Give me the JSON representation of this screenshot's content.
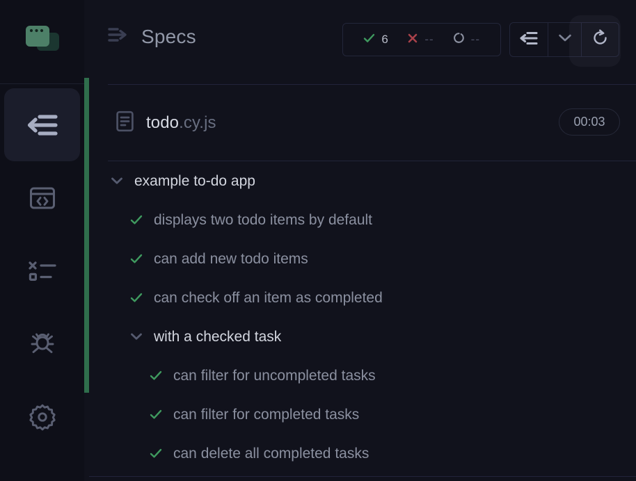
{
  "sidebar": {
    "logo": {
      "icon": "cypress-specs-logo-icon",
      "brand_color": "#4d8068",
      "shadow_color": "#1b3630"
    },
    "items": [
      {
        "id": "specs",
        "icon": "arrow-left-lines-icon",
        "label": "Specs",
        "active": true
      },
      {
        "id": "runs",
        "icon": "browser-code-icon",
        "label": "Runs",
        "active": false
      },
      {
        "id": "debug",
        "icon": "test-results-list-icon",
        "label": "Debug",
        "active": false
      },
      {
        "id": "bug",
        "icon": "bug-icon",
        "label": "Bug",
        "active": false
      },
      {
        "id": "settings",
        "icon": "gear-icon",
        "label": "Settings",
        "active": false
      }
    ]
  },
  "header": {
    "toggle_icon": "arrow-right-lines-icon",
    "title": "Specs",
    "stats": [
      {
        "id": "passed",
        "icon": "check-icon",
        "value": "6",
        "color": "#3f9a5f",
        "dim": false
      },
      {
        "id": "failed",
        "icon": "x-icon",
        "value": "--",
        "color": "#a8414a",
        "dim": true
      },
      {
        "id": "pending",
        "icon": "circle-dashed-icon",
        "value": "--",
        "color": "#8d92a2",
        "dim": true
      }
    ],
    "buttons": [
      {
        "id": "collapse-specs",
        "icon": "arrow-left-lines-icon",
        "focused": true
      },
      {
        "id": "more-options",
        "icon": "chevron-down-icon",
        "focused": false
      },
      {
        "id": "rerun",
        "icon": "refresh-icon",
        "focused": false
      }
    ]
  },
  "spec": {
    "file_icon": "file-lines-icon",
    "name_base": "todo",
    "name_ext": ".cy.js",
    "duration": "00:03",
    "status_color": "#2f6e4c"
  },
  "tree": {
    "rows": [
      {
        "depth": 0,
        "type": "suite",
        "marker": "chevron-down-icon",
        "label": "example to-do app"
      },
      {
        "depth": 1,
        "type": "test",
        "marker": "check-icon",
        "label": "displays two todo items by default"
      },
      {
        "depth": 1,
        "type": "test",
        "marker": "check-icon",
        "label": "can add new todo items"
      },
      {
        "depth": 1,
        "type": "test",
        "marker": "check-icon",
        "label": "can check off an item as completed"
      },
      {
        "depth": 1,
        "type": "suite",
        "marker": "chevron-down-icon",
        "label": "with a checked task"
      },
      {
        "depth": 2,
        "type": "test",
        "marker": "check-icon",
        "label": "can filter for uncompleted tasks"
      },
      {
        "depth": 2,
        "type": "test",
        "marker": "check-icon",
        "label": "can filter for completed tasks"
      },
      {
        "depth": 2,
        "type": "test",
        "marker": "check-icon",
        "label": "can delete all completed tasks"
      }
    ]
  },
  "colors": {
    "background": "#11121c",
    "sidebar_background": "#0e0f18",
    "active_nav": "#1b1d2b",
    "pass_green": "#3f9a5f",
    "fail_red": "#a8414a",
    "divider": "#22243a"
  }
}
